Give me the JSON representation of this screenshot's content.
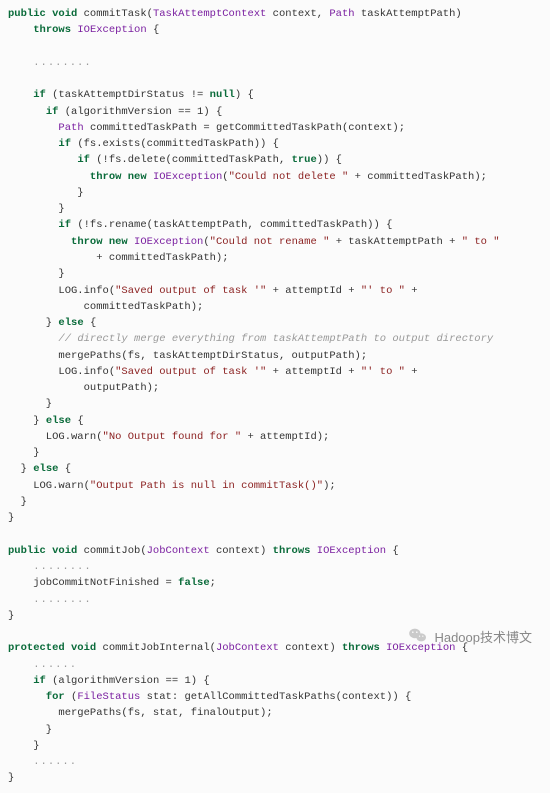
{
  "code": {
    "tokens": [
      {
        "t": "kw",
        "v": "public void"
      },
      {
        "t": "p",
        "v": " commitTask("
      },
      {
        "t": "cls",
        "v": "TaskAttemptContext"
      },
      {
        "t": "p",
        "v": " context, "
      },
      {
        "t": "cls",
        "v": "Path"
      },
      {
        "t": "p",
        "v": " taskAttemptPath)"
      },
      {
        "t": "nl"
      },
      {
        "t": "p",
        "v": "    "
      },
      {
        "t": "kw",
        "v": "throws"
      },
      {
        "t": "p",
        "v": " "
      },
      {
        "t": "cls",
        "v": "IOException"
      },
      {
        "t": "p",
        "v": " {"
      },
      {
        "t": "nl"
      },
      {
        "t": "nl"
      },
      {
        "t": "p",
        "v": "    "
      },
      {
        "t": "ell",
        "v": "........"
      },
      {
        "t": "nl"
      },
      {
        "t": "nl"
      },
      {
        "t": "p",
        "v": "    "
      },
      {
        "t": "kw",
        "v": "if"
      },
      {
        "t": "p",
        "v": " (taskAttemptDirStatus != "
      },
      {
        "t": "kw",
        "v": "null"
      },
      {
        "t": "p",
        "v": ") {"
      },
      {
        "t": "nl"
      },
      {
        "t": "p",
        "v": "      "
      },
      {
        "t": "kw",
        "v": "if"
      },
      {
        "t": "p",
        "v": " (algorithmVersion == 1) {"
      },
      {
        "t": "nl"
      },
      {
        "t": "p",
        "v": "        "
      },
      {
        "t": "cls",
        "v": "Path"
      },
      {
        "t": "p",
        "v": " committedTaskPath = getCommittedTaskPath(context);"
      },
      {
        "t": "nl"
      },
      {
        "t": "p",
        "v": "        "
      },
      {
        "t": "kw",
        "v": "if"
      },
      {
        "t": "p",
        "v": " (fs.exists(committedTaskPath)) {"
      },
      {
        "t": "nl"
      },
      {
        "t": "p",
        "v": "           "
      },
      {
        "t": "kw",
        "v": "if"
      },
      {
        "t": "p",
        "v": " (!fs.delete(committedTaskPath, "
      },
      {
        "t": "kw",
        "v": "true"
      },
      {
        "t": "p",
        "v": ")) {"
      },
      {
        "t": "nl"
      },
      {
        "t": "p",
        "v": "             "
      },
      {
        "t": "kw",
        "v": "throw new"
      },
      {
        "t": "p",
        "v": " "
      },
      {
        "t": "cls",
        "v": "IOException"
      },
      {
        "t": "p",
        "v": "("
      },
      {
        "t": "str",
        "v": "\"Could not delete \""
      },
      {
        "t": "p",
        "v": " + committedTaskPath);"
      },
      {
        "t": "nl"
      },
      {
        "t": "p",
        "v": "           }"
      },
      {
        "t": "nl"
      },
      {
        "t": "p",
        "v": "        }"
      },
      {
        "t": "nl"
      },
      {
        "t": "p",
        "v": "        "
      },
      {
        "t": "kw",
        "v": "if"
      },
      {
        "t": "p",
        "v": " (!fs.rename(taskAttemptPath, committedTaskPath)) {"
      },
      {
        "t": "nl"
      },
      {
        "t": "p",
        "v": "          "
      },
      {
        "t": "kw",
        "v": "throw new"
      },
      {
        "t": "p",
        "v": " "
      },
      {
        "t": "cls",
        "v": "IOException"
      },
      {
        "t": "p",
        "v": "("
      },
      {
        "t": "str",
        "v": "\"Could not rename \""
      },
      {
        "t": "p",
        "v": " + taskAttemptPath + "
      },
      {
        "t": "str",
        "v": "\" to \""
      },
      {
        "t": "nl"
      },
      {
        "t": "p",
        "v": "              + committedTaskPath);"
      },
      {
        "t": "nl"
      },
      {
        "t": "p",
        "v": "        }"
      },
      {
        "t": "nl"
      },
      {
        "t": "p",
        "v": "        LOG.info("
      },
      {
        "t": "str",
        "v": "\"Saved output of task '\""
      },
      {
        "t": "p",
        "v": " + attemptId + "
      },
      {
        "t": "str",
        "v": "\"' to \""
      },
      {
        "t": "p",
        "v": " +"
      },
      {
        "t": "nl"
      },
      {
        "t": "p",
        "v": "            committedTaskPath);"
      },
      {
        "t": "nl"
      },
      {
        "t": "p",
        "v": "      } "
      },
      {
        "t": "kw",
        "v": "else"
      },
      {
        "t": "p",
        "v": " {"
      },
      {
        "t": "nl"
      },
      {
        "t": "p",
        "v": "        "
      },
      {
        "t": "cmt",
        "v": "// directly merge everything from taskAttemptPath to output directory"
      },
      {
        "t": "nl"
      },
      {
        "t": "p",
        "v": "        mergePaths(fs, taskAttemptDirStatus, outputPath);"
      },
      {
        "t": "nl"
      },
      {
        "t": "p",
        "v": "        LOG.info("
      },
      {
        "t": "str",
        "v": "\"Saved output of task '\""
      },
      {
        "t": "p",
        "v": " + attemptId + "
      },
      {
        "t": "str",
        "v": "\"' to \""
      },
      {
        "t": "p",
        "v": " +"
      },
      {
        "t": "nl"
      },
      {
        "t": "p",
        "v": "            outputPath);"
      },
      {
        "t": "nl"
      },
      {
        "t": "p",
        "v": "      }"
      },
      {
        "t": "nl"
      },
      {
        "t": "p",
        "v": "    } "
      },
      {
        "t": "kw",
        "v": "else"
      },
      {
        "t": "p",
        "v": " {"
      },
      {
        "t": "nl"
      },
      {
        "t": "p",
        "v": "      LOG.warn("
      },
      {
        "t": "str",
        "v": "\"No Output found for \""
      },
      {
        "t": "p",
        "v": " + attemptId);"
      },
      {
        "t": "nl"
      },
      {
        "t": "p",
        "v": "    }"
      },
      {
        "t": "nl"
      },
      {
        "t": "p",
        "v": "  } "
      },
      {
        "t": "kw",
        "v": "else"
      },
      {
        "t": "p",
        "v": " {"
      },
      {
        "t": "nl"
      },
      {
        "t": "p",
        "v": "    LOG.warn("
      },
      {
        "t": "str",
        "v": "\"Output Path is null in commitTask()\""
      },
      {
        "t": "p",
        "v": ");"
      },
      {
        "t": "nl"
      },
      {
        "t": "p",
        "v": "  }"
      },
      {
        "t": "nl"
      },
      {
        "t": "p",
        "v": "}"
      },
      {
        "t": "nl"
      },
      {
        "t": "nl"
      },
      {
        "t": "kw",
        "v": "public void"
      },
      {
        "t": "p",
        "v": " commitJob("
      },
      {
        "t": "cls",
        "v": "JobContext"
      },
      {
        "t": "p",
        "v": " context) "
      },
      {
        "t": "kw",
        "v": "throws"
      },
      {
        "t": "p",
        "v": " "
      },
      {
        "t": "cls",
        "v": "IOException"
      },
      {
        "t": "p",
        "v": " {"
      },
      {
        "t": "nl"
      },
      {
        "t": "p",
        "v": "    "
      },
      {
        "t": "ell",
        "v": "........"
      },
      {
        "t": "nl"
      },
      {
        "t": "p",
        "v": "    jobCommitNotFinished = "
      },
      {
        "t": "kw",
        "v": "false"
      },
      {
        "t": "p",
        "v": ";"
      },
      {
        "t": "nl"
      },
      {
        "t": "p",
        "v": "    "
      },
      {
        "t": "ell",
        "v": "........"
      },
      {
        "t": "nl"
      },
      {
        "t": "p",
        "v": "}"
      },
      {
        "t": "nl"
      },
      {
        "t": "nl"
      },
      {
        "t": "kw",
        "v": "protected void"
      },
      {
        "t": "p",
        "v": " commitJobInternal("
      },
      {
        "t": "cls",
        "v": "JobContext"
      },
      {
        "t": "p",
        "v": " context) "
      },
      {
        "t": "kw",
        "v": "throws"
      },
      {
        "t": "p",
        "v": " "
      },
      {
        "t": "cls",
        "v": "IOException"
      },
      {
        "t": "p",
        "v": " {"
      },
      {
        "t": "nl"
      },
      {
        "t": "p",
        "v": "    "
      },
      {
        "t": "ell",
        "v": "......"
      },
      {
        "t": "nl"
      },
      {
        "t": "p",
        "v": "    "
      },
      {
        "t": "kw",
        "v": "if"
      },
      {
        "t": "p",
        "v": " (algorithmVersion == 1) {"
      },
      {
        "t": "nl"
      },
      {
        "t": "p",
        "v": "      "
      },
      {
        "t": "kw",
        "v": "for"
      },
      {
        "t": "p",
        "v": " ("
      },
      {
        "t": "cls",
        "v": "FileStatus"
      },
      {
        "t": "p",
        "v": " stat: getAllCommittedTaskPaths(context)) {"
      },
      {
        "t": "nl"
      },
      {
        "t": "p",
        "v": "        mergePaths(fs, stat, finalOutput);"
      },
      {
        "t": "nl"
      },
      {
        "t": "p",
        "v": "      }"
      },
      {
        "t": "nl"
      },
      {
        "t": "p",
        "v": "    }"
      },
      {
        "t": "nl"
      },
      {
        "t": "p",
        "v": "    "
      },
      {
        "t": "ell",
        "v": "......"
      },
      {
        "t": "nl"
      },
      {
        "t": "p",
        "v": "}"
      }
    ]
  },
  "watermark": {
    "text": "Hadoop技术博文"
  }
}
